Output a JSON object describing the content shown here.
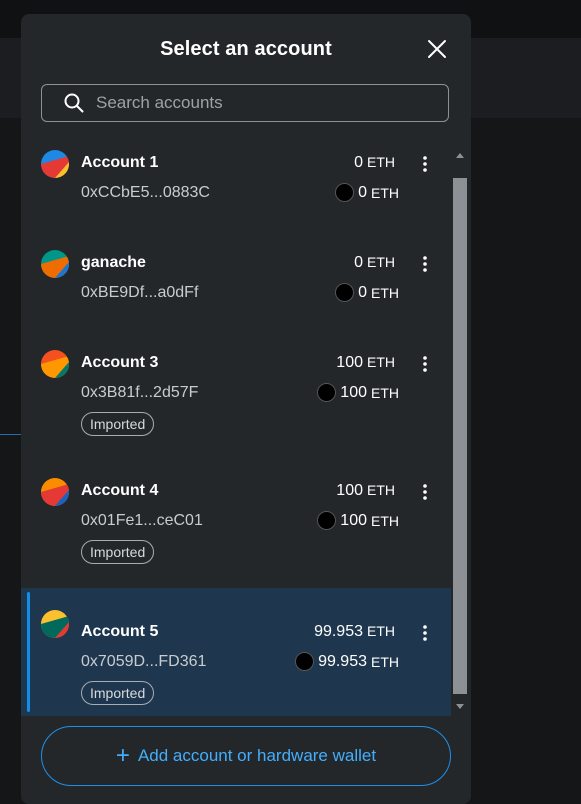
{
  "modal": {
    "title": "Select an account",
    "search_placeholder": "Search accounts",
    "add_button_label": "Add account or hardware wallet"
  },
  "accounts": [
    {
      "name": "Account 1",
      "address": "0xCCbE5...0883C",
      "balance": "0",
      "fiat_balance": "0",
      "unit": "ETH",
      "badge": "",
      "selected": false,
      "avatar_colors": [
        "#1e88e5",
        "#e53935",
        "#fbc02d"
      ]
    },
    {
      "name": "ganache",
      "address": "0xBE9Df...a0dFf",
      "balance": "0",
      "fiat_balance": "0",
      "unit": "ETH",
      "badge": "",
      "selected": false,
      "avatar_colors": [
        "#009688",
        "#ef6c00",
        "#1976d2"
      ]
    },
    {
      "name": "Account 3",
      "address": "0x3B81f...2d57F",
      "balance": "100",
      "fiat_balance": "100",
      "unit": "ETH",
      "badge": "Imported",
      "selected": false,
      "avatar_colors": [
        "#f4511e",
        "#ff9800",
        "#00796b"
      ]
    },
    {
      "name": "Account 4",
      "address": "0x01Fe1...ceC01",
      "balance": "100",
      "fiat_balance": "100",
      "unit": "ETH",
      "badge": "Imported",
      "selected": false,
      "avatar_colors": [
        "#fb8c00",
        "#e53935",
        "#1565c0"
      ]
    },
    {
      "name": "Account 5",
      "address": "0x7059D...FD361",
      "balance": "99.953",
      "fiat_balance": "99.953",
      "unit": "ETH",
      "badge": "Imported",
      "selected": true,
      "avatar_colors": [
        "#fbc02d",
        "#00695c",
        "#e53935"
      ]
    }
  ]
}
